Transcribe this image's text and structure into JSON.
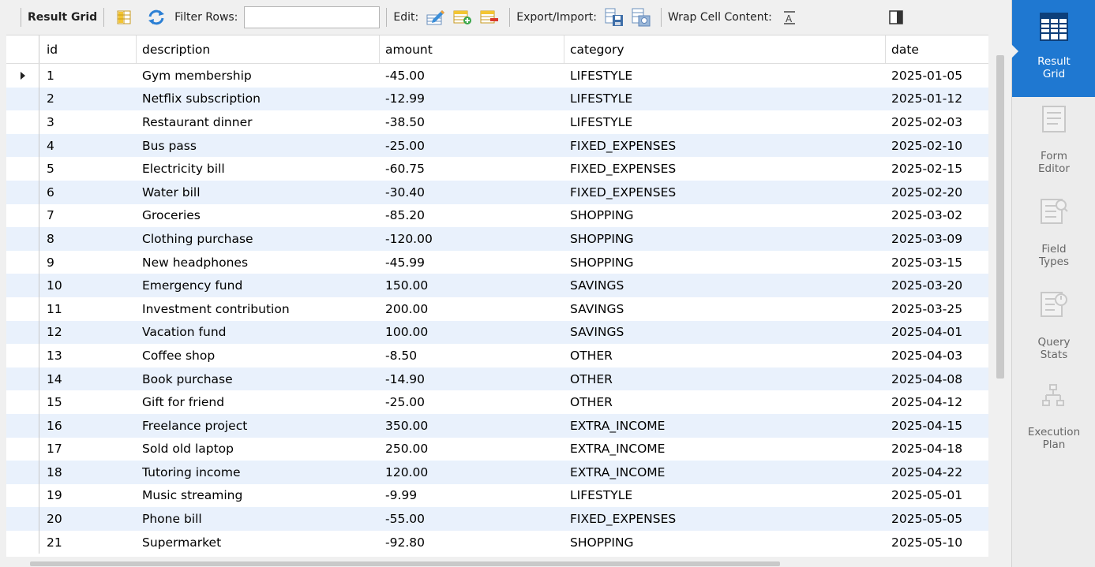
{
  "toolbar": {
    "result_grid": "Result Grid",
    "filter_rows": "Filter Rows:",
    "filter_value": "",
    "edit": "Edit:",
    "export_import": "Export/Import:",
    "wrap_cell_content": "Wrap Cell Content:"
  },
  "columns": [
    "id",
    "description",
    "amount",
    "category",
    "date"
  ],
  "rows": [
    [
      "1",
      "Gym membership",
      "-45.00",
      "LIFESTYLE",
      "2025-01-05"
    ],
    [
      "2",
      "Netflix subscription",
      "-12.99",
      "LIFESTYLE",
      "2025-01-12"
    ],
    [
      "3",
      "Restaurant dinner",
      "-38.50",
      "LIFESTYLE",
      "2025-02-03"
    ],
    [
      "4",
      "Bus pass",
      "-25.00",
      "FIXED_EXPENSES",
      "2025-02-10"
    ],
    [
      "5",
      "Electricity bill",
      "-60.75",
      "FIXED_EXPENSES",
      "2025-02-15"
    ],
    [
      "6",
      "Water bill",
      "-30.40",
      "FIXED_EXPENSES",
      "2025-02-20"
    ],
    [
      "7",
      "Groceries",
      "-85.20",
      "SHOPPING",
      "2025-03-02"
    ],
    [
      "8",
      "Clothing purchase",
      "-120.00",
      "SHOPPING",
      "2025-03-09"
    ],
    [
      "9",
      "New headphones",
      "-45.99",
      "SHOPPING",
      "2025-03-15"
    ],
    [
      "10",
      "Emergency fund",
      "150.00",
      "SAVINGS",
      "2025-03-20"
    ],
    [
      "11",
      "Investment contribution",
      "200.00",
      "SAVINGS",
      "2025-03-25"
    ],
    [
      "12",
      "Vacation fund",
      "100.00",
      "SAVINGS",
      "2025-04-01"
    ],
    [
      "13",
      "Coffee shop",
      "-8.50",
      "OTHER",
      "2025-04-03"
    ],
    [
      "14",
      "Book purchase",
      "-14.90",
      "OTHER",
      "2025-04-08"
    ],
    [
      "15",
      "Gift for friend",
      "-25.00",
      "OTHER",
      "2025-04-12"
    ],
    [
      "16",
      "Freelance project",
      "350.00",
      "EXTRA_INCOME",
      "2025-04-15"
    ],
    [
      "17",
      "Sold old laptop",
      "250.00",
      "EXTRA_INCOME",
      "2025-04-18"
    ],
    [
      "18",
      "Tutoring income",
      "120.00",
      "EXTRA_INCOME",
      "2025-04-22"
    ],
    [
      "19",
      "Music streaming",
      "-9.99",
      "LIFESTYLE",
      "2025-05-01"
    ],
    [
      "20",
      "Phone bill",
      "-55.00",
      "FIXED_EXPENSES",
      "2025-05-05"
    ],
    [
      "21",
      "Supermarket",
      "-92.80",
      "SHOPPING",
      "2025-05-10"
    ]
  ],
  "sidebar": {
    "result_grid": [
      "Result",
      "Grid"
    ],
    "form_editor": [
      "Form",
      "Editor"
    ],
    "field_types": [
      "Field",
      "Types"
    ],
    "query_stats": [
      "Query",
      "Stats"
    ],
    "execution_plan": [
      "Execution",
      "Plan"
    ]
  },
  "colors": {
    "accent": "#1f78d1",
    "row_alt": "#e9f1fc"
  }
}
